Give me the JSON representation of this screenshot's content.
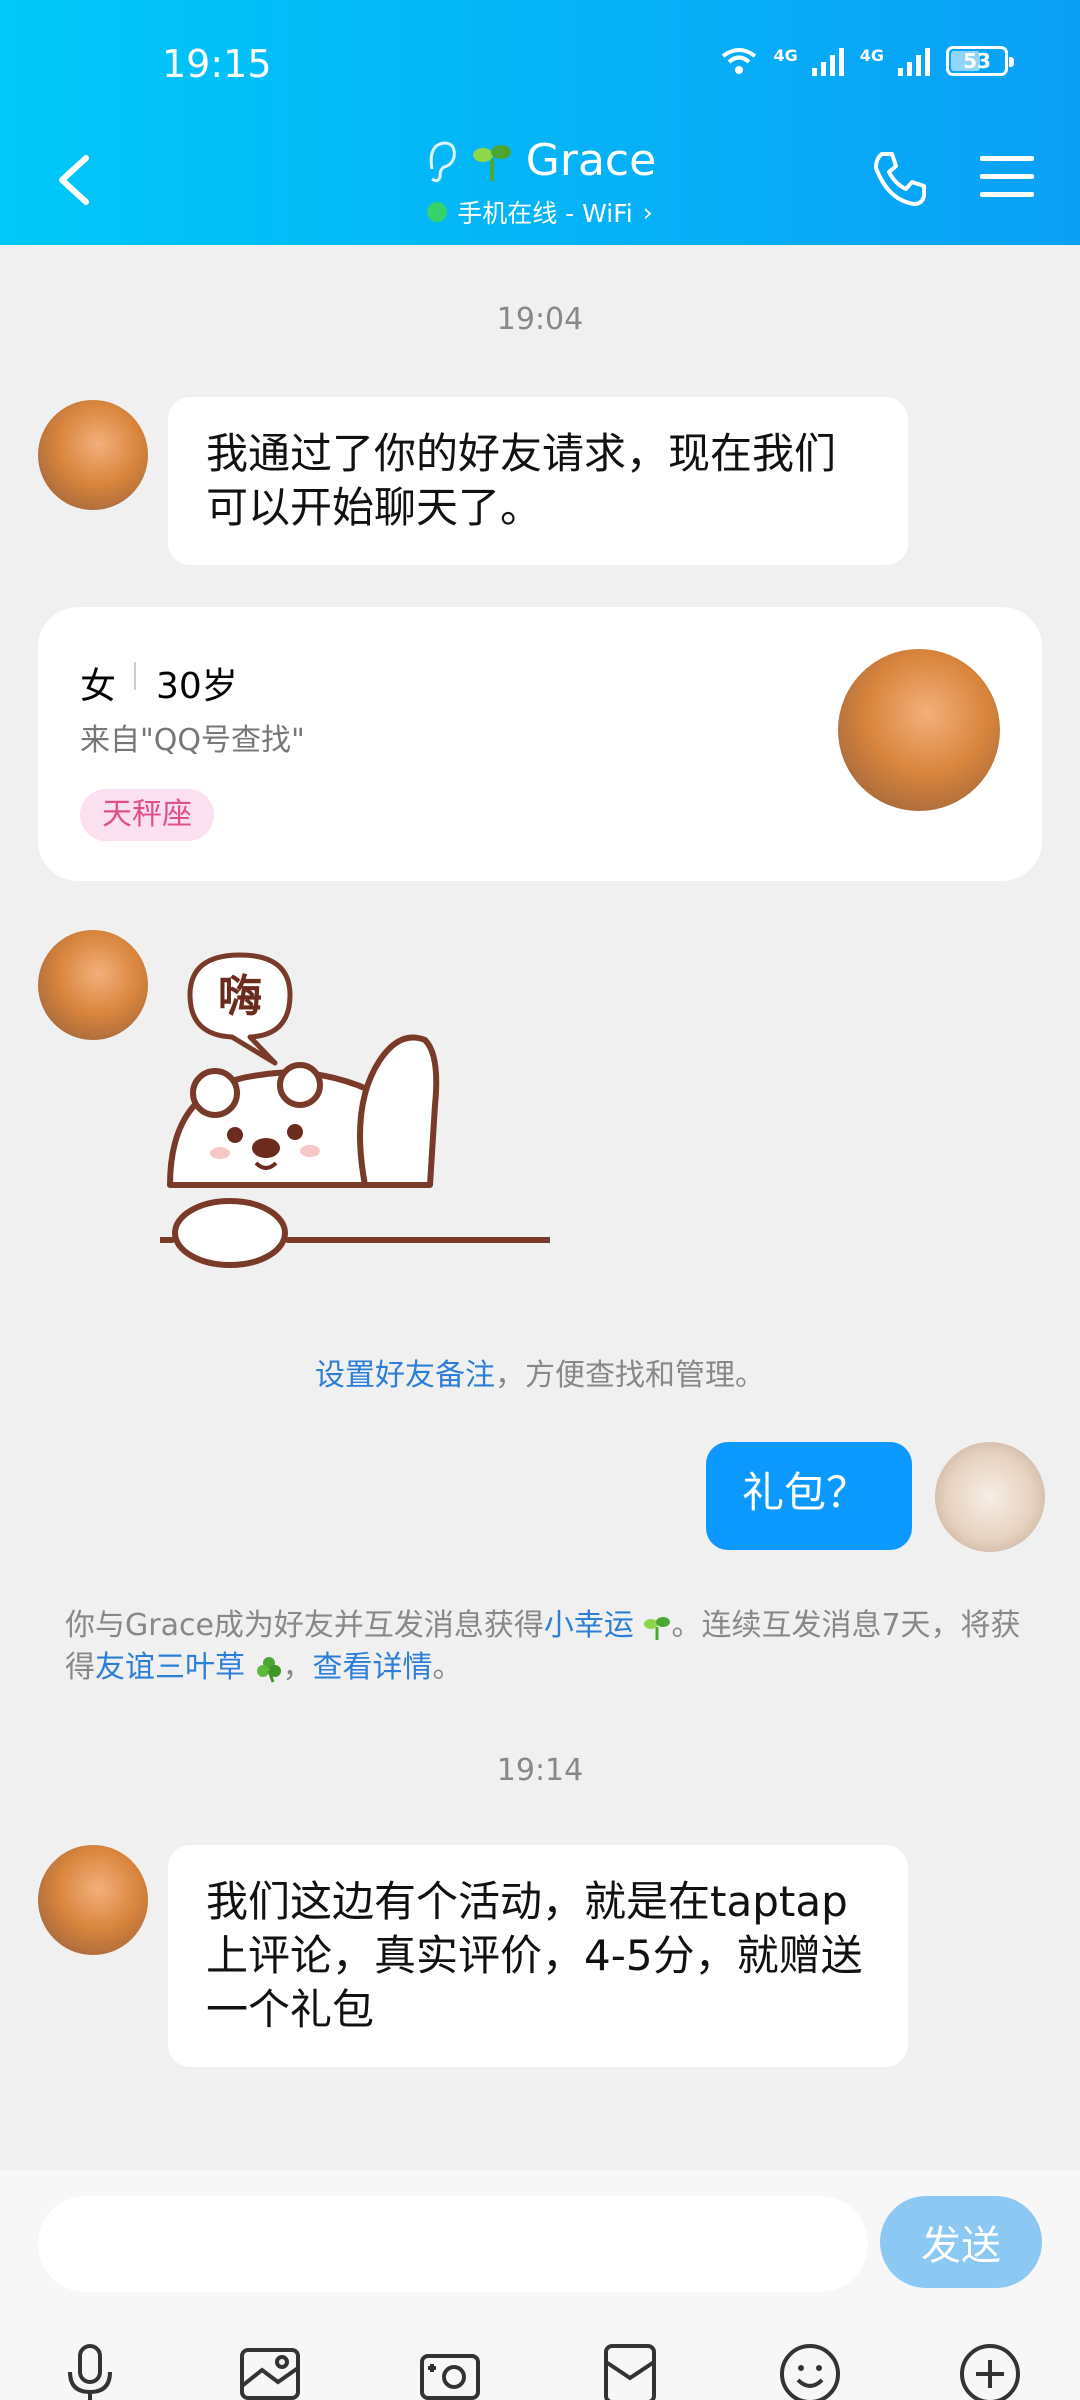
{
  "status_bar": {
    "time": "19:15",
    "battery": "53",
    "network_a": "4G",
    "network_b": "4G"
  },
  "header": {
    "title": "Grace",
    "subtitle": "手机在线 - WiFi",
    "colors": {
      "gradient_start": "#00c8f8",
      "gradient_end": "#0aa0f6"
    }
  },
  "messages": {
    "ts1": "19:04",
    "m1": "我通过了你的好友请求，现在我们可以开始聊天了。",
    "profile": {
      "gender": "女",
      "age": "30岁",
      "source": "来自\"QQ号查找\"",
      "tag": "天秤座"
    },
    "sticker_text": "嗨",
    "sys_link": "设置好友备注",
    "sys_rest": "，方便查找和管理。",
    "m_me": "礼包？",
    "sys2_part1": "你与Grace成为好友并互发消息获得",
    "sys2_link1": "小幸运",
    "sys2_part2": "。连续互发消息7天，将获得",
    "sys2_link2": "友谊三叶草",
    "sys2_part3": "，",
    "sys2_link3": "查看详情",
    "sys2_part4": "。",
    "ts2": "19:14",
    "m2": "我们这边有个活动，就是在taptap上评论，真实评价，4-5分，就赠送一个礼包"
  },
  "input": {
    "placeholder": "",
    "send_label": "发送"
  },
  "toolbar_icons": [
    "microphone-icon",
    "image-icon",
    "camera-icon",
    "red-packet-icon",
    "emoji-icon",
    "plus-icon"
  ],
  "colors": {
    "accent": "#0b99ff",
    "link": "#2c7ed6",
    "background": "#f0f0f0"
  }
}
